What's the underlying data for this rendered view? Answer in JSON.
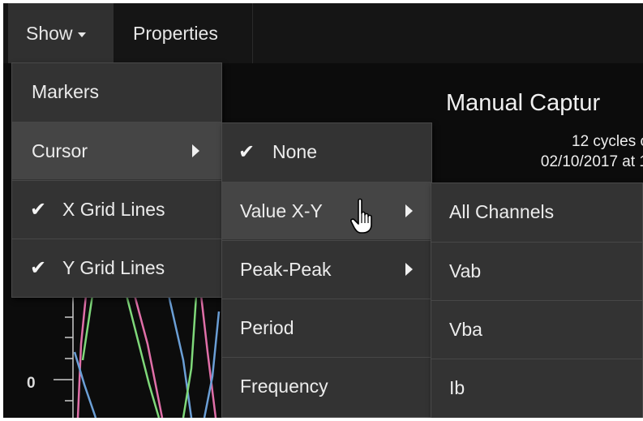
{
  "toolbar": {
    "show_label": "Show",
    "properties_label": "Properties"
  },
  "chart": {
    "title": "Manual Captur",
    "subtitle_line1": "12 cycles c",
    "subtitle_line2": "02/10/2017 at 1",
    "y_tick_label": "0",
    "series_colors": [
      "#e06fa8",
      "#7fd87a",
      "#6b9fd6"
    ]
  },
  "show_menu": {
    "items": [
      {
        "label": "Markers",
        "checked": false,
        "submenu": false
      },
      {
        "label": "Cursor",
        "checked": false,
        "submenu": true
      },
      {
        "label": "X Grid Lines",
        "checked": true,
        "submenu": false
      },
      {
        "label": "Y Grid Lines",
        "checked": true,
        "submenu": false
      }
    ]
  },
  "cursor_menu": {
    "items": [
      {
        "label": "None",
        "checked": true,
        "submenu": false
      },
      {
        "label": "Value X-Y",
        "checked": false,
        "submenu": true
      },
      {
        "label": "Peak-Peak",
        "checked": false,
        "submenu": true
      },
      {
        "label": "Period",
        "checked": false,
        "submenu": false
      },
      {
        "label": "Frequency",
        "checked": false,
        "submenu": false
      }
    ]
  },
  "value_xy_menu": {
    "items": [
      {
        "label": "All Channels"
      },
      {
        "label": "Vab"
      },
      {
        "label": "Vba"
      },
      {
        "label": "Ib"
      }
    ]
  },
  "icons": {
    "check": "✔",
    "caret": "caret-down-icon",
    "submenu_arrow": "chevron-right-icon",
    "pointer": "hand-pointer-icon"
  }
}
